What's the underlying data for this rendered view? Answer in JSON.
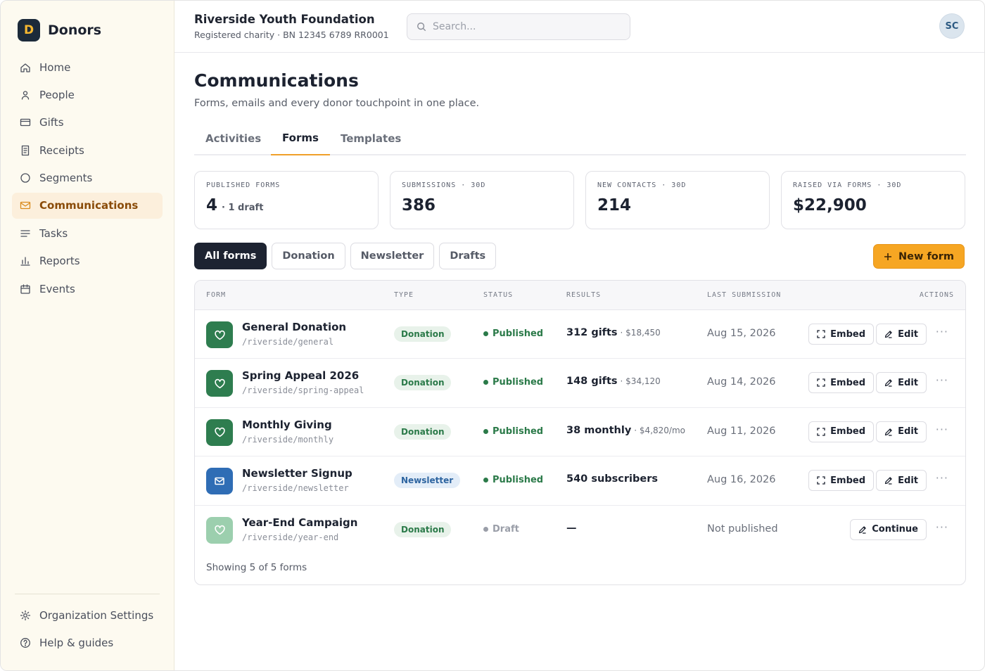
{
  "brand": {
    "mark": "D",
    "name": "Donors"
  },
  "nav": [
    {
      "label": "Home",
      "icon": "home-icon"
    },
    {
      "label": "People",
      "icon": "person-icon"
    },
    {
      "label": "Gifts",
      "icon": "card-icon"
    },
    {
      "label": "Receipts",
      "icon": "receipt-icon"
    },
    {
      "label": "Segments",
      "icon": "circle-icon"
    },
    {
      "label": "Communications",
      "icon": "mail-icon",
      "active": true
    },
    {
      "label": "Tasks",
      "icon": "list-icon"
    },
    {
      "label": "Reports",
      "icon": "bar-chart-icon"
    },
    {
      "label": "Events",
      "icon": "calendar-icon"
    }
  ],
  "nav_bottom": [
    {
      "label": "Organization Settings",
      "icon": "gear-icon"
    },
    {
      "label": "Help & guides",
      "icon": "help-icon"
    }
  ],
  "header": {
    "org_name": "Riverside Youth Foundation",
    "org_sub": "Registered charity · BN 12345 6789 RR0001",
    "search_placeholder": "Search...",
    "avatar": "SC"
  },
  "page": {
    "title": "Communications",
    "subtitle": "Forms, emails and every donor touchpoint in one place."
  },
  "tabs": [
    {
      "label": "Activities"
    },
    {
      "label": "Forms",
      "active": true
    },
    {
      "label": "Templates"
    }
  ],
  "stats": [
    {
      "label": "PUBLISHED FORMS",
      "value": "4",
      "extra": "· 1 draft"
    },
    {
      "label": "SUBMISSIONS · 30D",
      "value": "386",
      "extra": ""
    },
    {
      "label": "NEW CONTACTS · 30D",
      "value": "214",
      "extra": ""
    },
    {
      "label": "RAISED VIA FORMS · 30D",
      "value": "$22,900",
      "extra": ""
    }
  ],
  "filters": [
    {
      "label": "All forms",
      "active": true
    },
    {
      "label": "Donation"
    },
    {
      "label": "Newsletter"
    },
    {
      "label": "Drafts"
    }
  ],
  "new_form_label": "New form",
  "table": {
    "headers": {
      "form": "FORM",
      "type": "TYPE",
      "status": "STATUS",
      "results": "RESULTS",
      "last": "LAST SUBMISSION",
      "actions": "ACTIONS"
    },
    "rows": [
      {
        "name": "General Donation",
        "slug": "/riverside/general",
        "type": "Donation",
        "kind": "donation",
        "status": "Published",
        "result": "312 gifts",
        "result_sub": "· $18,450",
        "last": "Aug 15, 2026",
        "actions": [
          "Embed",
          "Edit"
        ]
      },
      {
        "name": "Spring Appeal 2026",
        "slug": "/riverside/spring-appeal",
        "type": "Donation",
        "kind": "donation",
        "status": "Published",
        "result": "148 gifts",
        "result_sub": "· $34,120",
        "last": "Aug 14, 2026",
        "actions": [
          "Embed",
          "Edit"
        ]
      },
      {
        "name": "Monthly Giving",
        "slug": "/riverside/monthly",
        "type": "Donation",
        "kind": "donation",
        "status": "Published",
        "result": "38 monthly",
        "result_sub": "· $4,820/mo",
        "last": "Aug 11, 2026",
        "actions": [
          "Embed",
          "Edit"
        ]
      },
      {
        "name": "Newsletter Signup",
        "slug": "/riverside/newsletter",
        "type": "Newsletter",
        "kind": "newsletter",
        "status": "Published",
        "result": "540 subscribers",
        "result_sub": "",
        "last": "Aug 16, 2026",
        "actions": [
          "Embed",
          "Edit"
        ]
      },
      {
        "name": "Year-End Campaign",
        "slug": "/riverside/year-end",
        "type": "Donation",
        "kind": "draft",
        "status": "Draft",
        "result": "—",
        "result_sub": "",
        "last": "Not published",
        "actions": [
          "Continue"
        ]
      }
    ],
    "footer": "Showing 5 of 5 forms"
  },
  "colors": {
    "accent": "#f6a623",
    "published": "#2b7a49",
    "draft": "#9a9ea8",
    "donation_icon": "#2e7d4f",
    "newsletter_icon": "#2f6db5",
    "draft_icon": "#9ccfae"
  }
}
